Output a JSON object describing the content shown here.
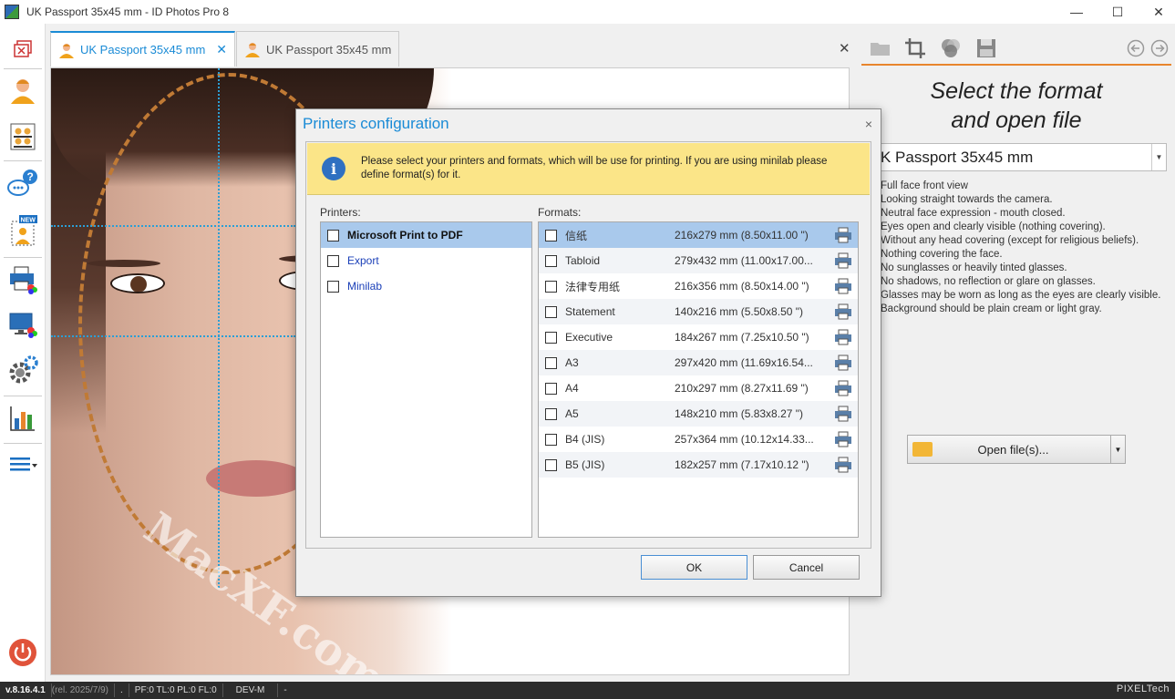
{
  "window": {
    "title": "UK Passport 35x45 mm - ID Photos Pro 8",
    "minimize": "—",
    "maximize": "☐",
    "close": "✕"
  },
  "tabs": [
    {
      "label": "UK Passport 35x45 mm",
      "active": true,
      "close": "✕"
    },
    {
      "label": "UK Passport 35x45 mm",
      "active": false
    }
  ],
  "center_close": "✕",
  "rail_new_badge": "NEW",
  "photo": {
    "watermark": "MacXF.com"
  },
  "right_panel": {
    "title_line1": "Select the format",
    "title_line2": "and open file",
    "format_value": "K Passport 35x45 mm",
    "description": [
      "Full face front view",
      "Looking straight towards the camera.",
      "Neutral face expression - mouth closed.",
      "Eyes open and clearly visible (nothing covering).",
      "Without any head covering (except for religious beliefs).",
      "Nothing covering the face.",
      "No sunglasses or heavily tinted glasses.",
      "No shadows, no reflection or glare on glasses.",
      "Glasses may be worn as long as the eyes are clearly visible.",
      "Background should be plain cream or light gray."
    ],
    "open_button": "Open file(s)..."
  },
  "dialog": {
    "title": "Printers configuration",
    "close": "×",
    "info_text": "Please select your printers and formats, which will be use for printing. If you are using minilab please define format(s) for it.",
    "printers_label": "Printers:",
    "formats_label": "Formats:",
    "printers": [
      {
        "name": "Microsoft Print to PDF",
        "selected": true
      },
      {
        "name": "Export",
        "selected": false
      },
      {
        "name": "Minilab",
        "selected": false
      }
    ],
    "formats": [
      {
        "name": "信纸",
        "size": "216x279 mm (8.50x11.00 \")"
      },
      {
        "name": "Tabloid",
        "size": "279x432 mm (11.00x17.00..."
      },
      {
        "name": "法律专用纸",
        "size": "216x356 mm (8.50x14.00 \")"
      },
      {
        "name": "Statement",
        "size": "140x216 mm (5.50x8.50 \")"
      },
      {
        "name": "Executive",
        "size": "184x267 mm (7.25x10.50 \")"
      },
      {
        "name": "A3",
        "size": "297x420 mm (11.69x16.54..."
      },
      {
        "name": "A4",
        "size": "210x297 mm (8.27x11.69 \")"
      },
      {
        "name": "A5",
        "size": "148x210 mm (5.83x8.27 \")"
      },
      {
        "name": "B4 (JIS)",
        "size": "257x364 mm (10.12x14.33..."
      },
      {
        "name": "B5 (JIS)",
        "size": "182x257 mm (7.17x10.12 \")"
      }
    ],
    "ok": "OK",
    "cancel": "Cancel"
  },
  "statusbar": {
    "version": "v.8.16.4.1",
    "release": "(rel. 2025/7/9)",
    "dot": ".",
    "flags": "PF:0 TL:0 PL:0 FL:0",
    "mode": "DEV-M",
    "dash": "-",
    "brand": "PIXELTech"
  },
  "colors": {
    "accent": "#1a8bd6",
    "orange": "#e8852c",
    "info_bg": "#fbe588",
    "selected_row": "#a9c9ec"
  }
}
